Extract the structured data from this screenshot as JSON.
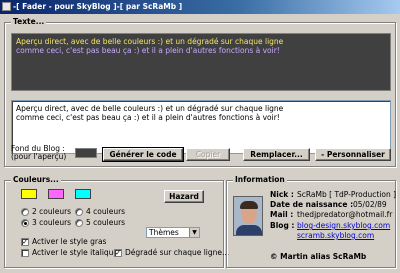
{
  "window": {
    "title": "-[ Fader - pour SkyBlog ]-[ par ScRaMb ]"
  },
  "texte": {
    "legend": "Texte...",
    "preview_line1": "Aperçu direct, avec de belle couleurs :) et un dégradé sur chaque ligne",
    "preview_line2": "comme ceci, c'est pas beau ça :) et il a plein d'autres fonctions à voir!",
    "editor_line1": "Aperçu direct, avec de belle couleurs :) et un dégradé sur chaque ligne",
    "editor_line2": "comme ceci, c'est pas beau ça :) et il a plein d'autres fonctions à voir!",
    "bg_label_1": "Fond du Blog :",
    "bg_label_2": "(pour l'aperçu)",
    "bg_color": "#404040",
    "btn_generate": "Générer le code",
    "btn_copy": "Copier",
    "btn_replace": "Remplacer...",
    "btn_customize": "- Personnaliser"
  },
  "couleurs": {
    "legend": "Couleurs...",
    "swatches": [
      "#ffff00",
      "#ff66ff",
      "#00ffff"
    ],
    "btn_random": "Hazard",
    "radio_2": "2 couleurs",
    "radio_3": "3 couleurs",
    "radio_4": "4 couleurs",
    "radio_5": "5 couleurs",
    "selected_count": "3",
    "themes_value": "Thèmes",
    "check_bold": "Activer le style gras",
    "check_italic": "Activer le style italique",
    "check_gradient": "Dégradé sur chaque ligne...",
    "bold_checked": true,
    "italic_checked": false,
    "gradient_checked": true
  },
  "information": {
    "legend": "Information",
    "nick_label": "Nick :",
    "nick_value": "ScRaMb [ TdP-Production ]",
    "birth_label": "Date de naissance :",
    "birth_value": "05/02/89",
    "mail_label": "Mail :",
    "mail_value": "thedjpredator@hotmail.fr",
    "blog_label": "Blog :",
    "blog_link1": "blog-design.skyblog.com",
    "blog_link2": "scramb.skyblog.com",
    "copyright": "© Martin alias ScRaMb"
  }
}
